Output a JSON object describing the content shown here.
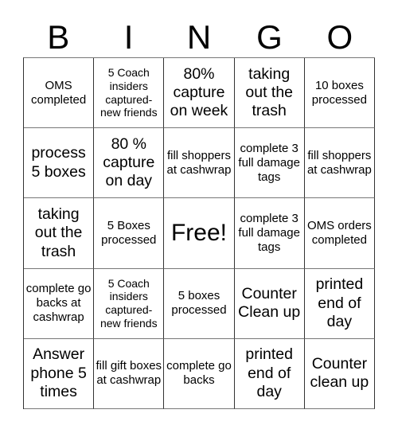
{
  "header": {
    "letters": [
      "B",
      "I",
      "N",
      "G",
      "O"
    ]
  },
  "board": {
    "rows": [
      [
        {
          "text": "OMS completed",
          "size": "m"
        },
        {
          "text": "5 Coach insiders captured-new friends",
          "size": "s"
        },
        {
          "text": "80% capture on week",
          "size": "l"
        },
        {
          "text": "taking out the trash",
          "size": "l"
        },
        {
          "text": "10 boxes processed",
          "size": "m"
        }
      ],
      [
        {
          "text": "process 5 boxes",
          "size": "l"
        },
        {
          "text": "80 % capture on day",
          "size": "l"
        },
        {
          "text": "fill shoppers at cashwrap",
          "size": "m"
        },
        {
          "text": "complete 3 full damage tags",
          "size": "m"
        },
        {
          "text": "fill shoppers at cashwrap",
          "size": "m"
        }
      ],
      [
        {
          "text": "taking out the trash",
          "size": "l"
        },
        {
          "text": "5 Boxes processed",
          "size": "m"
        },
        {
          "text": "Free!",
          "size": "xl",
          "free": true
        },
        {
          "text": "complete 3 full damage tags",
          "size": "m"
        },
        {
          "text": "OMS orders completed",
          "size": "m"
        }
      ],
      [
        {
          "text": "complete go backs at cashwrap",
          "size": "m"
        },
        {
          "text": "5 Coach insiders captured-new friends",
          "size": "s"
        },
        {
          "text": "5 boxes processed",
          "size": "m"
        },
        {
          "text": "Counter Clean up",
          "size": "l"
        },
        {
          "text": "printed end of day",
          "size": "l"
        }
      ],
      [
        {
          "text": "Answer phone 5 times",
          "size": "l"
        },
        {
          "text": "fill gift boxes at cashwrap",
          "size": "m"
        },
        {
          "text": "complete go backs",
          "size": "m"
        },
        {
          "text": "printed end of day",
          "size": "l"
        },
        {
          "text": "Counter clean up",
          "size": "l"
        }
      ]
    ]
  }
}
